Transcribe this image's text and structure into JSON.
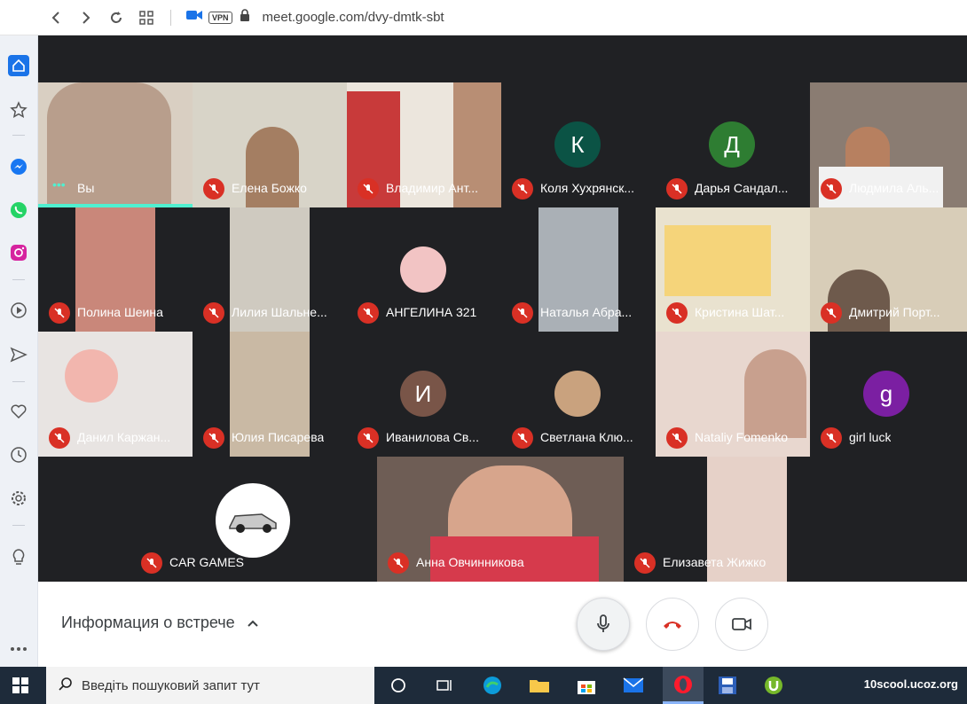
{
  "browser": {
    "url": "meet.google.com/dvy-dmtk-sbt",
    "vpn_label": "VPN"
  },
  "participants": [
    {
      "name": "Вы",
      "muted": false,
      "avatar": null
    },
    {
      "name": "Елена Божко",
      "muted": true,
      "avatar": null
    },
    {
      "name": "Владимир Ант...",
      "muted": true,
      "avatar": null
    },
    {
      "name": "Коля Хухрянск...",
      "muted": true,
      "avatar": {
        "letter": "К",
        "color": "#0b5345"
      }
    },
    {
      "name": "Дарья Сандал...",
      "muted": true,
      "avatar": {
        "letter": "Д",
        "color": "#2e7d32"
      }
    },
    {
      "name": "Людмила Аль...",
      "muted": true,
      "avatar": null
    },
    {
      "name": "Полина Шеина",
      "muted": true,
      "avatar": null
    },
    {
      "name": "Лилия Шальне...",
      "muted": true,
      "avatar": null
    },
    {
      "name": "АНГЕЛИНА 321",
      "muted": true,
      "avatar": {
        "letter": "",
        "color": "#f2c4c4"
      }
    },
    {
      "name": "Наталья Абра...",
      "muted": true,
      "avatar": null
    },
    {
      "name": "Кристина Шат...",
      "muted": true,
      "avatar": null
    },
    {
      "name": "Дмитрий Порт...",
      "muted": true,
      "avatar": null
    },
    {
      "name": "Данил Каржан...",
      "muted": true,
      "avatar": null
    },
    {
      "name": "Юлия Писарева",
      "muted": true,
      "avatar": null
    },
    {
      "name": "Иванилова Св...",
      "muted": true,
      "avatar": {
        "letter": "И",
        "color": "#795548"
      }
    },
    {
      "name": "Светлана Клю...",
      "muted": true,
      "avatar": {
        "letter": "",
        "color": "#c9a27e"
      }
    },
    {
      "name": "Nataliy Fomenko",
      "muted": true,
      "avatar": null
    },
    {
      "name": "girl luck",
      "muted": true,
      "avatar": {
        "letter": "g",
        "color": "#7b1fa2"
      }
    },
    {
      "name": "CAR GAMES",
      "muted": true,
      "avatar": {
        "letter": "",
        "color": "#ffffff"
      }
    },
    {
      "name": "Анна Овчинникова",
      "muted": true,
      "avatar": null
    },
    {
      "name": "Елизавета Жижко",
      "muted": true,
      "avatar": null
    }
  ],
  "bottom_bar": {
    "meeting_info": "Информация о встрече"
  },
  "taskbar": {
    "search_placeholder": "Введіть пошуковий запит тут",
    "watermark": "10scool.ucoz.org"
  },
  "colors": {
    "meet_bg": "#202124",
    "mute_red": "#d93025",
    "hangup_red": "#d93025",
    "active_speaker": "#4ff0d0"
  }
}
